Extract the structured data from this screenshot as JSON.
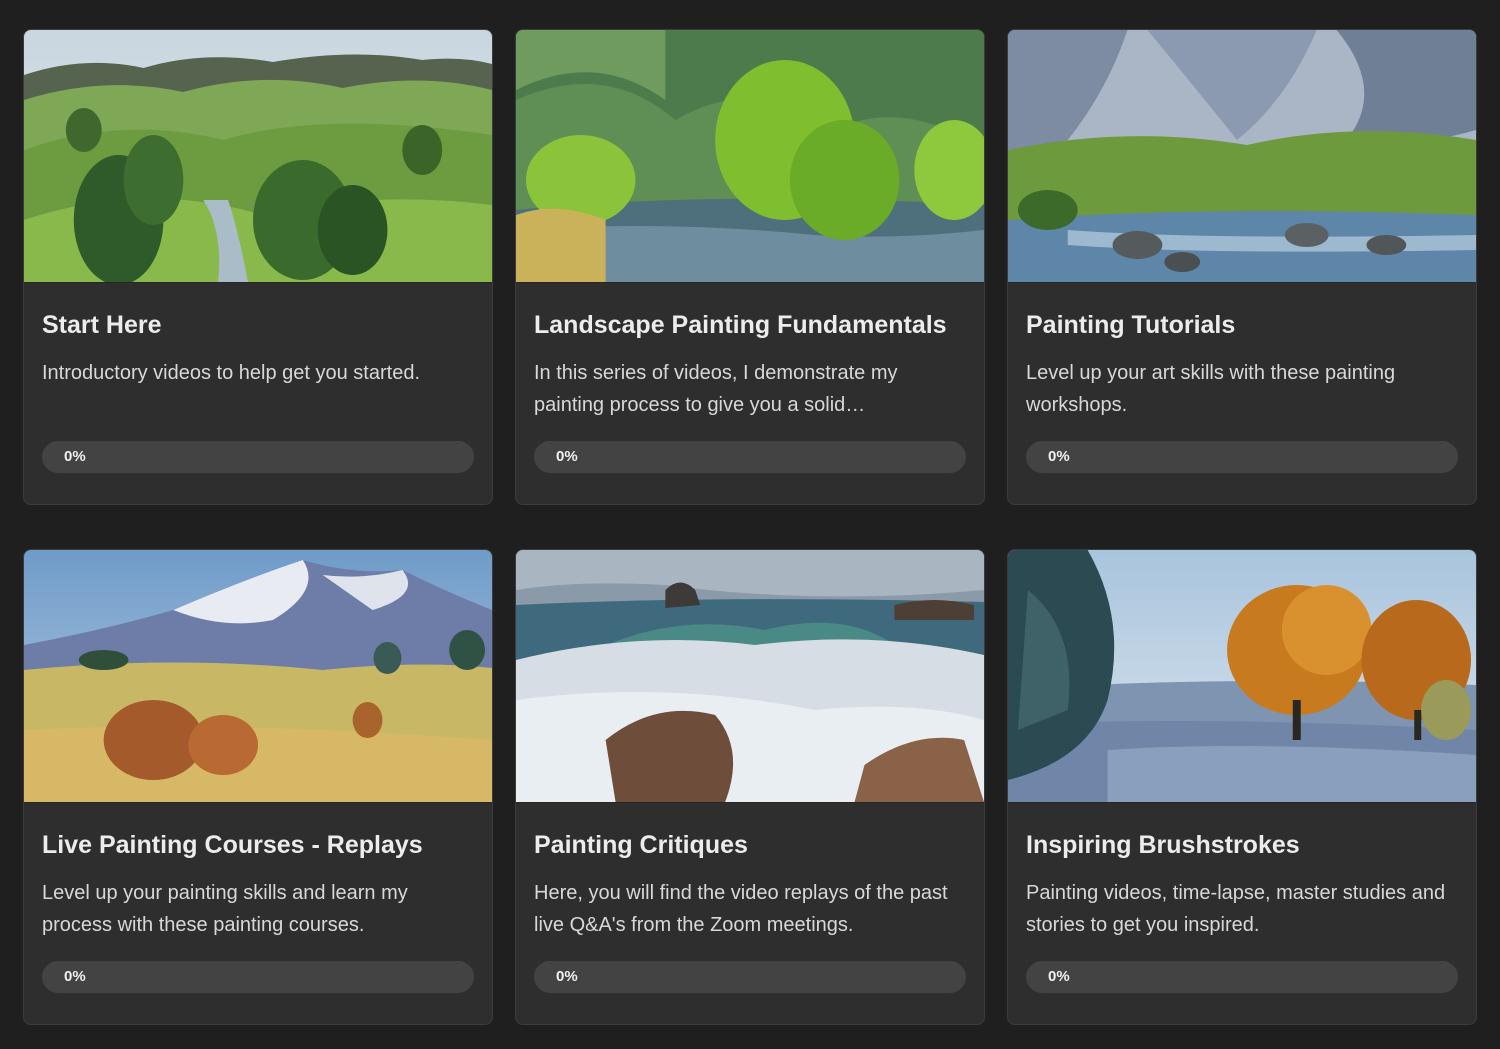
{
  "courses": [
    {
      "title": "Start Here",
      "description": "Introductory videos to help get you started.",
      "progress_label": "0%",
      "progress": 0,
      "image": "green-hills-landscape-painting"
    },
    {
      "title": "Landscape Painting Fundamentals",
      "description": "In this series of videos, I demonstrate my painting process to give you a solid…",
      "progress_label": "0%",
      "progress": 0,
      "image": "river-willows-painting"
    },
    {
      "title": "Painting Tutorials",
      "description": "Level up your art skills with these painting workshops.",
      "progress_label": "0%",
      "progress": 0,
      "image": "mountain-stream-painting"
    },
    {
      "title": "Live Painting Courses - Replays",
      "description": "Level up your painting skills and learn my process with these painting courses.",
      "progress_label": "0%",
      "progress": 0,
      "image": "snowy-mountain-golden-field-painting"
    },
    {
      "title": "Painting Critiques",
      "description": "Here, you will find the video replays of the past live Q&A's from the Zoom meetings.",
      "progress_label": "0%",
      "progress": 0,
      "image": "crashing-waves-painting"
    },
    {
      "title": "Inspiring Brushstrokes",
      "description": "Painting videos, time-lapse, master studies and stories to get you inspired.",
      "progress_label": "0%",
      "progress": 0,
      "image": "autumn-trees-frost-painting"
    }
  ],
  "colors": {
    "page_background": "#1f1f1f",
    "card_background": "#2e2e2e",
    "progress_track": "#434343"
  }
}
